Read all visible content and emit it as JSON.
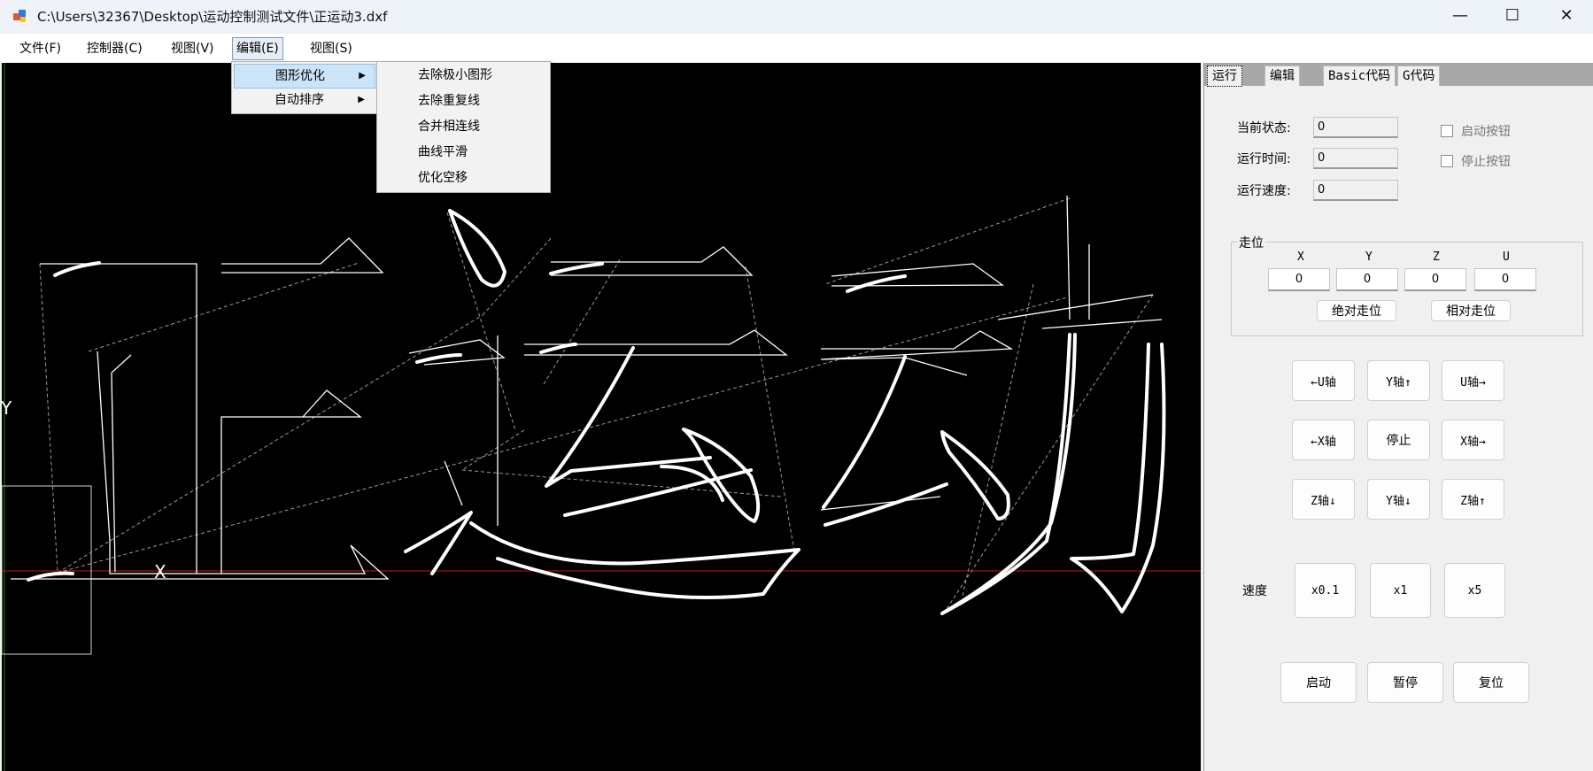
{
  "window": {
    "title": "C:\\Users\\32367\\Desktop\\运动控制测试文件\\正运动3.dxf",
    "minimize_glyph": "—",
    "maximize_glyph": "☐",
    "close_glyph": "✕"
  },
  "menubar": {
    "items": [
      {
        "label": "文件(F)"
      },
      {
        "label": "控制器(C)"
      },
      {
        "label": "视图(V)"
      },
      {
        "label": "编辑(E)"
      },
      {
        "label": "视图(S)"
      }
    ]
  },
  "edit_menu": {
    "items": [
      {
        "label": "图形优化"
      },
      {
        "label": "自动排序"
      }
    ],
    "arrow": "▶"
  },
  "optimize_submenu": {
    "items": [
      {
        "label": "去除极小图形"
      },
      {
        "label": "去除重复线"
      },
      {
        "label": "合并相连线"
      },
      {
        "label": "曲线平滑"
      },
      {
        "label": "优化空移"
      }
    ]
  },
  "canvas": {
    "x_axis_label": "X",
    "y_axis_label": "Y",
    "axis_color": "#d01010",
    "path_color": "#ffffff"
  },
  "tabs": [
    {
      "label": "运行"
    },
    {
      "label": "编辑"
    },
    {
      "label": "Basic代码"
    },
    {
      "label": "G代码"
    }
  ],
  "status": {
    "current_state_label": "当前状态:",
    "current_state_value": "0",
    "run_time_label": "运行时间:",
    "run_time_value": "0",
    "run_speed_label": "运行速度:",
    "run_speed_value": "0",
    "start_button_check": "启动按钮",
    "stop_button_check": "停止按钮"
  },
  "jog": {
    "group_title": "走位",
    "axes": [
      {
        "label": "X",
        "value": "0"
      },
      {
        "label": "Y",
        "value": "0"
      },
      {
        "label": "Z",
        "value": "0"
      },
      {
        "label": "U",
        "value": "0"
      }
    ],
    "absolute_button": "绝对走位",
    "relative_button": "相对走位"
  },
  "axis_buttons": {
    "u_minus": "←U轴",
    "y_plus": "Y轴↑",
    "u_plus": "U轴→",
    "x_minus": "←X轴",
    "stop": "停止",
    "x_plus": "X轴→",
    "z_minus": "Z轴↓",
    "y_minus": "Y轴↓",
    "z_plus": "Z轴↑"
  },
  "speed": {
    "label": "速度",
    "options": [
      "x0.1",
      "x1",
      "x5"
    ]
  },
  "control": {
    "start": "启动",
    "pause": "暂停",
    "reset": "复位"
  }
}
